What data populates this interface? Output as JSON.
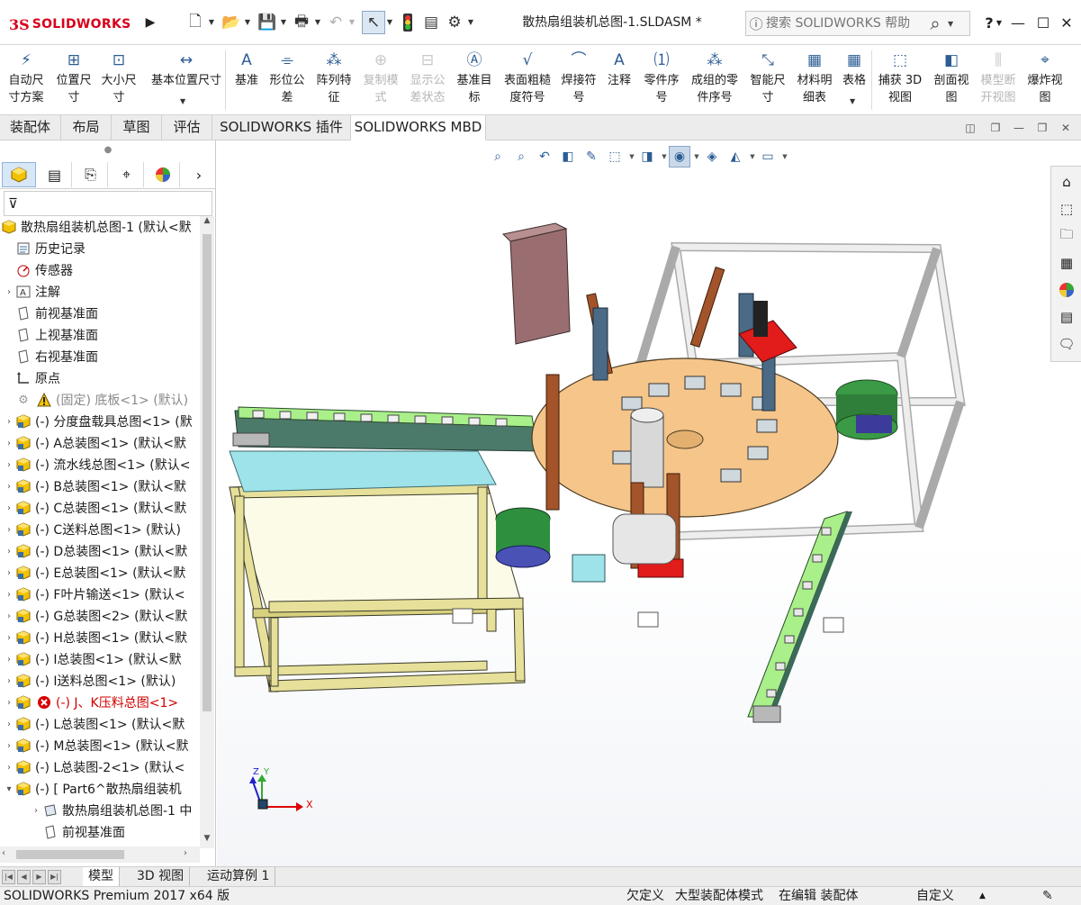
{
  "app": {
    "logo_ds": "3S",
    "logo_text": "SOLIDWORKS",
    "document_title": "散热扇组装机总图-1.SLDASM *",
    "search_placeholder": "搜索 SOLIDWORKS 帮助",
    "help": "?"
  },
  "ribbon": {
    "buttons": [
      {
        "label": "自动尺\n寸方案",
        "icon": "auto-dimension-icon",
        "enabled": true
      },
      {
        "label": "位置尺\n寸",
        "icon": "location-dimension-icon",
        "enabled": true
      },
      {
        "label": "大小尺\n寸",
        "icon": "size-dimension-icon",
        "enabled": true
      },
      {
        "label": "基本位置尺寸",
        "icon": "basic-location-dimension-icon",
        "enabled": true
      },
      {
        "label": "基准",
        "icon": "datum-icon",
        "enabled": true
      },
      {
        "label": "形位公\n差",
        "icon": "geometric-tolerance-icon",
        "enabled": true
      },
      {
        "label": "阵列特\n征",
        "icon": "pattern-feature-icon",
        "enabled": true
      },
      {
        "label": "复制模\n式",
        "icon": "copy-scheme-icon",
        "enabled": false
      },
      {
        "label": "显示公\n差状态",
        "icon": "show-tolerance-status-icon",
        "enabled": false
      },
      {
        "label": "基准目\n标",
        "icon": "datum-target-icon",
        "enabled": true
      },
      {
        "label": "表面粗糙\n度符号",
        "icon": "surface-finish-icon",
        "enabled": true
      },
      {
        "label": "焊接符\n号",
        "icon": "weld-symbol-icon",
        "enabled": true
      },
      {
        "label": "注释",
        "icon": "note-icon",
        "enabled": true
      },
      {
        "label": "零件序\n号",
        "icon": "balloon-icon",
        "enabled": true
      },
      {
        "label": "成组的零\n件序号",
        "icon": "stacked-balloon-icon",
        "enabled": true
      },
      {
        "label": "智能尺\n寸",
        "icon": "smart-dimension-icon",
        "enabled": true
      },
      {
        "label": "材料明\n细表",
        "icon": "bom-icon",
        "enabled": true
      },
      {
        "label": "表格",
        "icon": "table-icon",
        "enabled": true
      },
      {
        "label": "捕获 3D\n视图",
        "icon": "capture-3d-view-icon",
        "enabled": true
      },
      {
        "label": "剖面视\n图",
        "icon": "section-view-icon",
        "enabled": true
      },
      {
        "label": "模型断\n开视图",
        "icon": "model-break-view-icon",
        "enabled": false
      },
      {
        "label": "爆炸视\n图",
        "icon": "exploded-view-icon",
        "enabled": true
      }
    ]
  },
  "cm_tabs": [
    "装配体",
    "布局",
    "草图",
    "评估",
    "SOLIDWORKS 插件",
    "SOLIDWORKS MBD"
  ],
  "cm_active": "SOLIDWORKS MBD",
  "tree": {
    "root": "散热扇组装机总图-1  (默认<默",
    "items": [
      {
        "label": "历史记录",
        "icon": "history-icon",
        "expand": false,
        "state": "normal"
      },
      {
        "label": "传感器",
        "icon": "sensor-icon",
        "expand": false,
        "state": "normal"
      },
      {
        "label": "注解",
        "icon": "annotations-icon",
        "expand": true,
        "state": "normal"
      },
      {
        "label": "前视基准面",
        "icon": "plane-icon",
        "expand": false,
        "state": "normal"
      },
      {
        "label": "上视基准面",
        "icon": "plane-icon",
        "expand": false,
        "state": "normal"
      },
      {
        "label": "右视基准面",
        "icon": "plane-icon",
        "expand": false,
        "state": "normal"
      },
      {
        "label": "原点",
        "icon": "origin-icon",
        "expand": false,
        "state": "normal"
      },
      {
        "label": "(固定) 底板<1> (默认)",
        "icon": "warning-icon",
        "expand": false,
        "state": "dim"
      },
      {
        "label": "(-) 分度盘载具总图<1> (默",
        "icon": "subassembly-icon",
        "expand": true,
        "state": "normal"
      },
      {
        "label": "(-) A总装图<1> (默认<默",
        "icon": "subassembly-icon",
        "expand": true,
        "state": "normal"
      },
      {
        "label": "(-) 流水线总图<1> (默认<",
        "icon": "subassembly-icon",
        "expand": true,
        "state": "normal"
      },
      {
        "label": "(-) B总装图<1> (默认<默",
        "icon": "subassembly-icon",
        "expand": true,
        "state": "normal"
      },
      {
        "label": "(-) C总装图<1> (默认<默",
        "icon": "subassembly-icon",
        "expand": true,
        "state": "normal"
      },
      {
        "label": "(-) C送料总图<1> (默认)",
        "icon": "subassembly-icon",
        "expand": true,
        "state": "normal"
      },
      {
        "label": "(-) D总装图<1> (默认<默",
        "icon": "subassembly-icon",
        "expand": true,
        "state": "normal"
      },
      {
        "label": "(-) E总装图<1> (默认<默",
        "icon": "subassembly-icon",
        "expand": true,
        "state": "normal"
      },
      {
        "label": "(-) F叶片输送<1> (默认<",
        "icon": "subassembly-icon",
        "expand": true,
        "state": "normal"
      },
      {
        "label": "(-) G总装图<2> (默认<默",
        "icon": "subassembly-icon",
        "expand": true,
        "state": "normal"
      },
      {
        "label": "(-) H总装图<1> (默认<默",
        "icon": "subassembly-icon",
        "expand": true,
        "state": "normal"
      },
      {
        "label": "(-) I总装图<1> (默认<默",
        "icon": "subassembly-icon",
        "expand": true,
        "state": "normal"
      },
      {
        "label": "(-) I送料总图<1> (默认)",
        "icon": "subassembly-icon",
        "expand": true,
        "state": "normal"
      },
      {
        "label": "(-) J、K压料总图<1>",
        "icon": "error-icon",
        "expand": true,
        "state": "err"
      },
      {
        "label": "(-) L总装图<1> (默认<默",
        "icon": "subassembly-icon",
        "expand": true,
        "state": "normal"
      },
      {
        "label": "(-) M总装图<1> (默认<默",
        "icon": "subassembly-icon",
        "expand": true,
        "state": "normal"
      },
      {
        "label": "(-) L总装图-2<1> (默认<",
        "icon": "subassembly-icon",
        "expand": true,
        "state": "normal"
      },
      {
        "label": "(-) [ Part6^散热扇组装机",
        "icon": "subassembly-icon",
        "expand": true,
        "state": "open"
      },
      {
        "label": "散热扇组装机总图-1 中",
        "icon": "feature-icon",
        "expand": true,
        "state": "child"
      },
      {
        "label": "前视基准面",
        "icon": "plane-icon",
        "expand": false,
        "state": "child"
      }
    ]
  },
  "bottom_tabs": [
    "模型",
    "3D 视图",
    "运动算例 1"
  ],
  "bottom_active": "模型",
  "status": {
    "product": "SOLIDWORKS Premium 2017 x64 版",
    "definition": "欠定义",
    "mode": "大型装配体模式",
    "editing": "在编辑 装配体",
    "units": "自定义"
  },
  "triad": {
    "x": "X",
    "y": "Y",
    "z": "Z"
  },
  "colors": {
    "brand": "#d9001b",
    "accent": "#2c5d93",
    "frame_yellow": "#e6e09a",
    "plate_tan": "#f2c27a",
    "conveyor_green": "#7ec96a",
    "frame_white": "#dcdcdc"
  }
}
